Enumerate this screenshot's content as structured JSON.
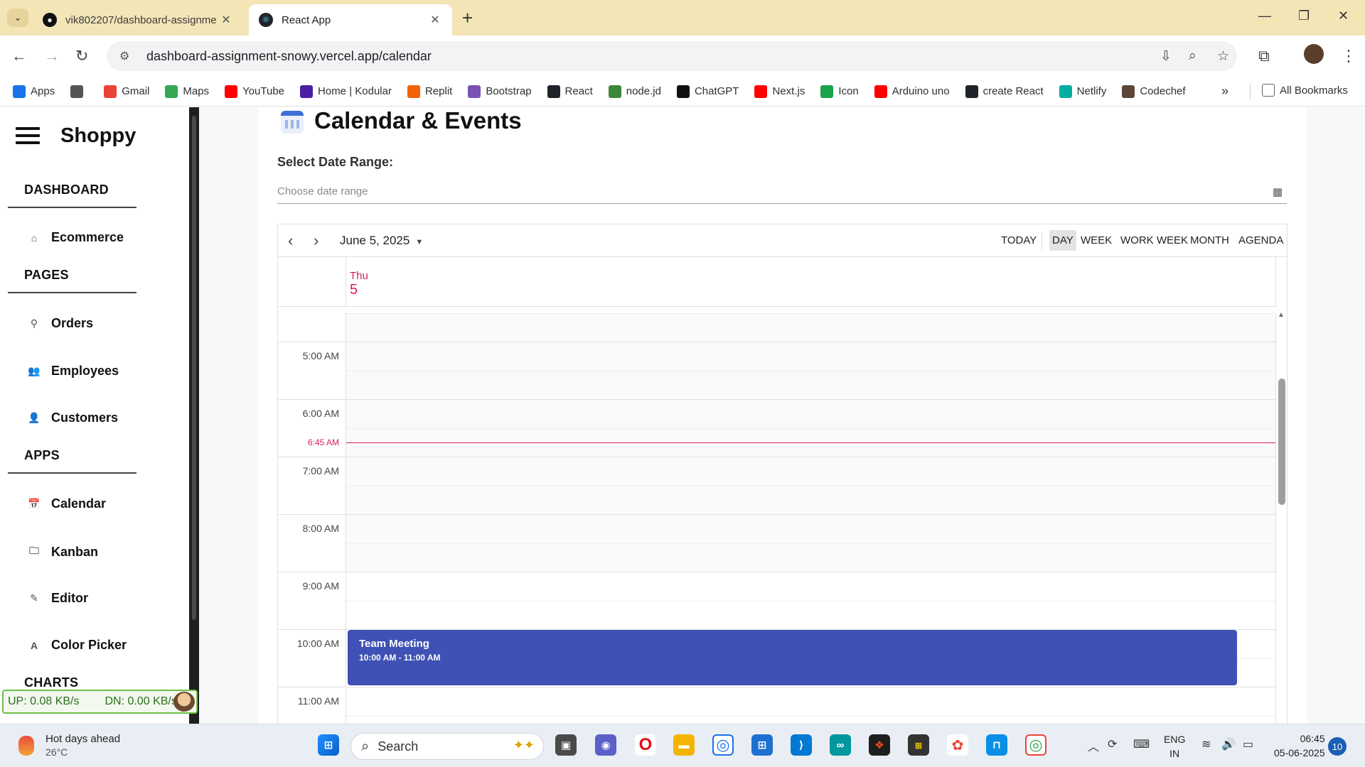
{
  "browser": {
    "tabs": [
      {
        "title": "vik802207/dashboard-assignme",
        "active": false,
        "icon": "github-icon"
      },
      {
        "title": "React App",
        "active": true,
        "icon": "react-icon"
      }
    ],
    "url": "dashboard-assignment-snowy.vercel.app/calendar",
    "bookmarks": [
      {
        "label": "Apps",
        "icon": "apps-grid-icon",
        "color": "#1a73e8"
      },
      {
        "label": "",
        "icon": "grid-icon",
        "color": "#555555"
      },
      {
        "label": "Gmail",
        "icon": "gmail-icon",
        "color": "#ea4335"
      },
      {
        "label": "Maps",
        "icon": "maps-icon",
        "color": "#34a853"
      },
      {
        "label": "YouTube",
        "icon": "youtube-icon",
        "color": "#ff0000"
      },
      {
        "label": "Home | Kodular",
        "icon": "kodular-icon",
        "color": "#4b1fa3"
      },
      {
        "label": "Replit",
        "icon": "replit-icon",
        "color": "#f26207"
      },
      {
        "label": "Bootstrap",
        "icon": "bootstrap-icon",
        "color": "#7952b3"
      },
      {
        "label": "React",
        "icon": "react-icon",
        "color": "#20232a"
      },
      {
        "label": "node.jd",
        "icon": "nodejs-icon",
        "color": "#3c873a"
      },
      {
        "label": "ChatGPT",
        "icon": "chatgpt-icon",
        "color": "#111111"
      },
      {
        "label": "Next.js",
        "icon": "youtube-icon",
        "color": "#ff0000"
      },
      {
        "label": "Icon",
        "icon": "icon-site-icon",
        "color": "#1aa34a"
      },
      {
        "label": "Arduino uno",
        "icon": "youtube-icon",
        "color": "#ff0000"
      },
      {
        "label": "create React",
        "icon": "react-icon",
        "color": "#20232a"
      },
      {
        "label": "Netlify",
        "icon": "netlify-icon",
        "color": "#00ad9f"
      },
      {
        "label": "Codechef",
        "icon": "codechef-icon",
        "color": "#5b4638"
      }
    ],
    "all_bookmarks": "All Bookmarks"
  },
  "sidebar": {
    "brand": "Shoppy",
    "sections": [
      {
        "title": "DASHBOARD",
        "items": [
          {
            "label": "Ecommerce",
            "icon": "home-icon"
          }
        ]
      },
      {
        "title": "PAGES",
        "items": [
          {
            "label": "Orders",
            "icon": "location-pin-icon"
          },
          {
            "label": "Employees",
            "icon": "people-icon"
          },
          {
            "label": "Customers",
            "icon": "person-icon"
          }
        ]
      },
      {
        "title": "APPS",
        "items": [
          {
            "label": "Calendar",
            "icon": "calendar-icon"
          },
          {
            "label": "Kanban",
            "icon": "folder-icon"
          },
          {
            "label": "Editor",
            "icon": "pencil-icon"
          },
          {
            "label": "Color Picker",
            "icon": "letter-a-icon"
          }
        ]
      },
      {
        "title": "CHARTS",
        "items": []
      }
    ]
  },
  "net_widget": {
    "up": "UP: 0.08 KB/s",
    "down": "DN: 0.00 KB/s"
  },
  "main": {
    "title": "Calendar & Events",
    "range_label": "Select Date Range:",
    "range_placeholder": "Choose date range"
  },
  "scheduler": {
    "current_date": "June 5, 2025",
    "views": [
      "TODAY",
      "DAY",
      "WEEK",
      "WORK WEEK",
      "MONTH",
      "AGENDA"
    ],
    "active_view": "DAY",
    "day_name": "Thu",
    "day_number": "5",
    "time_labels": [
      "5:00 AM",
      "6:00 AM",
      "7:00 AM",
      "8:00 AM",
      "9:00 AM",
      "10:00 AM",
      "11:00 AM"
    ],
    "now_label": "6:45 AM",
    "events": [
      {
        "title": "Team Meeting",
        "time": "10:00 AM - 11:00 AM",
        "color": "#3f51b5"
      }
    ],
    "accent_color": "#d81b60"
  },
  "taskbar": {
    "weather_title": "Hot days ahead",
    "weather_temp": "26°C",
    "search_placeholder": "Search",
    "lang_top": "ENG",
    "lang_bottom": "IN",
    "time": "06:45",
    "date": "05-06-2025",
    "notifications": "10"
  }
}
